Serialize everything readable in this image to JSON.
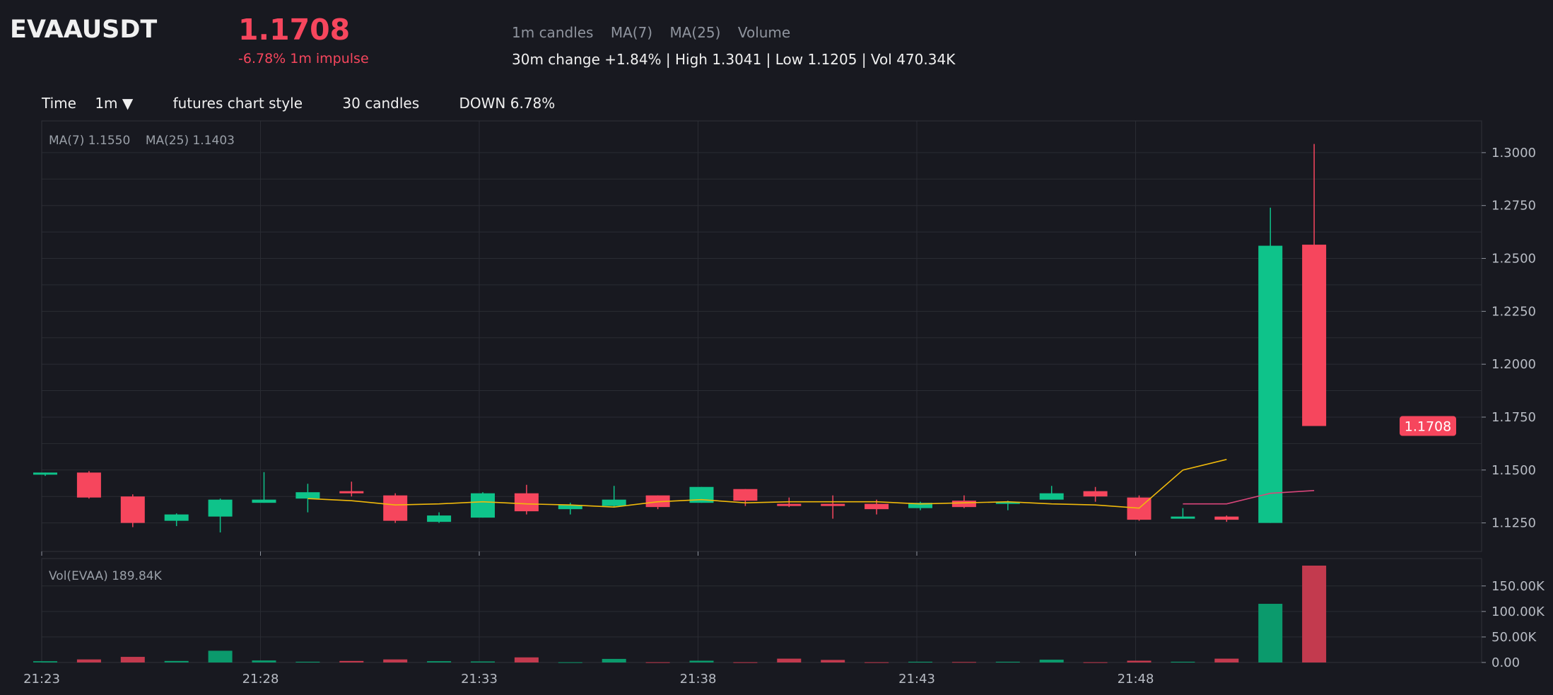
{
  "header": {
    "symbol": "EVAAUSDT",
    "price": "1.1708",
    "impulse": "-6.78% 1m impulse",
    "meta_items": [
      "1m candles",
      "MA(7)",
      "MA(25)",
      "Volume"
    ],
    "stats": "30m change +1.84% | High 1.3041 | Low 1.1205 | Vol 470.34K"
  },
  "toolbar": {
    "time_label": "Time",
    "interval": "1m ▼",
    "style": "futures chart style",
    "count": "30 candles",
    "direction": "DOWN 6.78%"
  },
  "colors": {
    "up": "#0ec38a",
    "down": "#f6465d",
    "ma7": "#f0b90b",
    "ma25": "#d9457a",
    "background": "#181920",
    "grid": "#2a2c33"
  },
  "chart_data": {
    "type": "candlestick",
    "price_legend": "MA(7) 1.1550    MA(25) 1.1403",
    "volume_legend": "Vol(EVAA) 189.84K",
    "last_price_label": "1.1708",
    "price_ticks": [
      "1.1250",
      "1.1500",
      "1.1750",
      "1.2000",
      "1.2250",
      "1.2500",
      "1.2750",
      "1.3000"
    ],
    "price_tick_values": [
      1.125,
      1.15,
      1.175,
      1.2,
      1.225,
      1.25,
      1.275,
      1.3
    ],
    "price_range": [
      1.1115,
      1.315
    ],
    "volume_ticks": [
      "0.00",
      "50.00K",
      "100.00K",
      "150.00K"
    ],
    "volume_tick_values": [
      0,
      50000,
      100000,
      150000
    ],
    "volume_range": [
      0,
      189840
    ],
    "time_ticks": [
      "21:23",
      "21:28",
      "21:33",
      "21:38",
      "21:43",
      "21:48"
    ],
    "time_tick_indices": [
      0,
      5,
      10,
      15,
      20,
      25
    ],
    "candles": [
      {
        "o": 1.148,
        "h": 1.1488,
        "l": 1.1472,
        "c": 1.1488,
        "v": 2500
      },
      {
        "o": 1.1488,
        "h": 1.1495,
        "l": 1.1365,
        "c": 1.137,
        "v": 6000
      },
      {
        "o": 1.1375,
        "h": 1.1385,
        "l": 1.123,
        "c": 1.125,
        "v": 11000
      },
      {
        "o": 1.126,
        "h": 1.1295,
        "l": 1.1235,
        "c": 1.129,
        "v": 3000
      },
      {
        "o": 1.128,
        "h": 1.1365,
        "l": 1.1205,
        "c": 1.136,
        "v": 23000
      },
      {
        "o": 1.1345,
        "h": 1.149,
        "l": 1.1345,
        "c": 1.136,
        "v": 4000
      },
      {
        "o": 1.1365,
        "h": 1.1435,
        "l": 1.13,
        "c": 1.1395,
        "v": 1500
      },
      {
        "o": 1.14,
        "h": 1.1445,
        "l": 1.1375,
        "c": 1.139,
        "v": 3000
      },
      {
        "o": 1.138,
        "h": 1.139,
        "l": 1.125,
        "c": 1.126,
        "v": 6000
      },
      {
        "o": 1.1255,
        "h": 1.13,
        "l": 1.125,
        "c": 1.1285,
        "v": 2500
      },
      {
        "o": 1.1275,
        "h": 1.1395,
        "l": 1.1275,
        "c": 1.139,
        "v": 2000
      },
      {
        "o": 1.139,
        "h": 1.143,
        "l": 1.129,
        "c": 1.1305,
        "v": 10000
      },
      {
        "o": 1.1315,
        "h": 1.1345,
        "l": 1.129,
        "c": 1.1335,
        "v": 500
      },
      {
        "o": 1.133,
        "h": 1.1425,
        "l": 1.1325,
        "c": 1.136,
        "v": 7000
      },
      {
        "o": 1.138,
        "h": 1.138,
        "l": 1.1315,
        "c": 1.1325,
        "v": 500
      },
      {
        "o": 1.1345,
        "h": 1.142,
        "l": 1.1345,
        "c": 1.142,
        "v": 3500
      },
      {
        "o": 1.141,
        "h": 1.141,
        "l": 1.133,
        "c": 1.1355,
        "v": 500
      },
      {
        "o": 1.134,
        "h": 1.137,
        "l": 1.1325,
        "c": 1.133,
        "v": 7500
      },
      {
        "o": 1.134,
        "h": 1.138,
        "l": 1.127,
        "c": 1.1335,
        "v": 5000
      },
      {
        "o": 1.134,
        "h": 1.136,
        "l": 1.129,
        "c": 1.1315,
        "v": 500
      },
      {
        "o": 1.132,
        "h": 1.135,
        "l": 1.131,
        "c": 1.1345,
        "v": 1500
      },
      {
        "o": 1.1355,
        "h": 1.138,
        "l": 1.132,
        "c": 1.1325,
        "v": 1000
      },
      {
        "o": 1.134,
        "h": 1.1355,
        "l": 1.131,
        "c": 1.135,
        "v": 1500
      },
      {
        "o": 1.136,
        "h": 1.1425,
        "l": 1.136,
        "c": 1.139,
        "v": 5500
      },
      {
        "o": 1.14,
        "h": 1.142,
        "l": 1.135,
        "c": 1.1375,
        "v": 500
      },
      {
        "o": 1.137,
        "h": 1.138,
        "l": 1.126,
        "c": 1.1265,
        "v": 3500
      },
      {
        "o": 1.127,
        "h": 1.132,
        "l": 1.127,
        "c": 1.128,
        "v": 1500
      },
      {
        "o": 1.128,
        "h": 1.1285,
        "l": 1.1255,
        "c": 1.1265,
        "v": 7500
      },
      {
        "o": 1.125,
        "h": 1.274,
        "l": 1.125,
        "c": 1.256,
        "v": 115000
      },
      {
        "o": 1.2565,
        "h": 1.3041,
        "l": 1.1708,
        "c": 1.1708,
        "v": 189840
      }
    ],
    "ma7": [
      null,
      null,
      null,
      null,
      null,
      null,
      1.1365,
      1.1355,
      1.1335,
      1.134,
      1.135,
      1.134,
      1.1335,
      1.1325,
      1.135,
      1.136,
      1.1345,
      1.135,
      1.135,
      1.135,
      1.134,
      1.1345,
      1.135,
      1.134,
      1.1335,
      1.132,
      1.15,
      1.155
    ],
    "ma7_start": 6,
    "ma25": [
      1.134,
      1.134,
      1.139,
      1.1403
    ],
    "ma25_start": 26
  }
}
